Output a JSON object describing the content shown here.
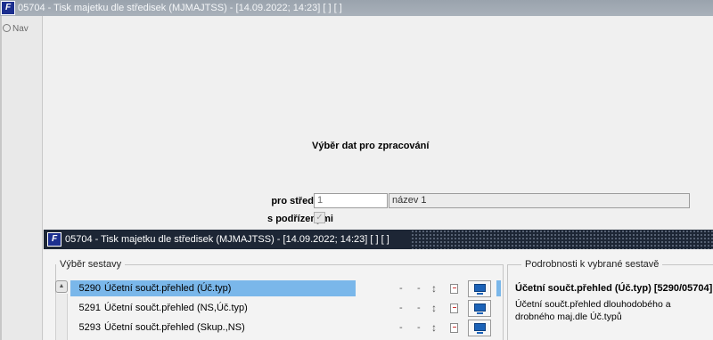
{
  "window": {
    "title": "05704 - Tisk  majetku dle středisek (MJMAJTSS) - [14.09.2022; 14:23]  [ ]  [ ]",
    "icon": "app-logo-icon"
  },
  "nav": {
    "label": "Nav"
  },
  "form": {
    "heading": "Výběr dat pro zpracování",
    "stredisko_label": "pro středisko",
    "stredisko_value": "1",
    "stredisko_name": "název 1",
    "podrizene_label": "s podřízenými",
    "podrizene_checked": true
  },
  "subwindow": {
    "title": "05704 - Tisk  majetku dle středisek (MJMAJTSS) - [14.09.2022; 14:23]  [ ]  [ ]"
  },
  "reports": {
    "legend": "Výběr sestavy",
    "rows": [
      {
        "code": "5290",
        "name": "Účetní součt.přehled (Úč.typ)",
        "col1": "-",
        "col2": "-",
        "selected": true
      },
      {
        "code": "5291",
        "name": "Účetní součt.přehled (NS,Úč.typ)",
        "col1": "-",
        "col2": "-",
        "selected": false
      },
      {
        "code": "5293",
        "name": "Účetní součt.přehled (Skup.,NS)",
        "col1": "-",
        "col2": "-",
        "selected": false
      }
    ]
  },
  "details": {
    "legend": "Podrobnosti k vybrané sestavě",
    "title": "Účetní součt.přehled (Úč.typ) [5290/05704]",
    "description": "Účetní součt.přehled dlouhodobého a drobného maj.dle Úč.typů"
  },
  "colors": {
    "titlebar": "#a3abb4",
    "subbar": "#1d2635",
    "selection": "#7ab7ea",
    "monitor_icon": "#1b62b7"
  }
}
